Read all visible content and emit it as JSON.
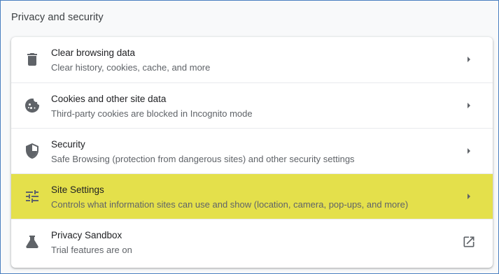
{
  "section": {
    "title": "Privacy and security"
  },
  "items": [
    {
      "title": "Clear browsing data",
      "subtitle": "Clear history, cookies, cache, and more",
      "icon": "trash-icon",
      "action_icon": "chevron-right-icon"
    },
    {
      "title": "Cookies and other site data",
      "subtitle": "Third-party cookies are blocked in Incognito mode",
      "icon": "cookie-icon",
      "action_icon": "chevron-right-icon"
    },
    {
      "title": "Security",
      "subtitle": "Safe Browsing (protection from dangerous sites) and other security settings",
      "icon": "shield-icon",
      "action_icon": "chevron-right-icon"
    },
    {
      "title": "Site Settings",
      "subtitle": "Controls what information sites can use and show (location, camera, pop-ups, and more)",
      "icon": "tune-sliders-icon",
      "action_icon": "chevron-right-icon",
      "highlighted": true
    },
    {
      "title": "Privacy Sandbox",
      "subtitle": "Trial features are on",
      "icon": "flask-icon",
      "action_icon": "open-in-new-icon"
    }
  ],
  "colors": {
    "highlight": "#e4e04b",
    "icon": "#5f6368",
    "title_text": "#202124",
    "subtitle_text": "#5f6368"
  }
}
